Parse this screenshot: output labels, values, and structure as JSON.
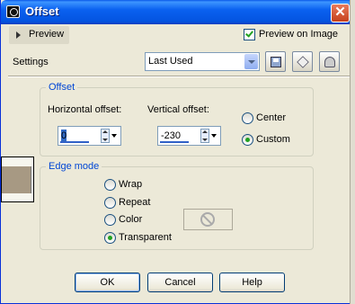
{
  "window": {
    "title": "Offset",
    "close_glyph": "✕"
  },
  "preview_toggle": {
    "label": "Preview"
  },
  "preview_on_image": {
    "label": "Preview on Image",
    "checked": true
  },
  "settings": {
    "label": "Settings",
    "value": "Last Used"
  },
  "offset_group": {
    "legend": "Offset",
    "horizontal": {
      "label": "Horizontal offset:",
      "value": "0"
    },
    "vertical": {
      "label": "Vertical offset:",
      "value": "-230"
    },
    "radios": [
      {
        "label": "Center",
        "selected": false
      },
      {
        "label": "Custom",
        "selected": true
      }
    ]
  },
  "edge_group": {
    "legend": "Edge mode",
    "radios": [
      {
        "label": "Wrap",
        "selected": false
      },
      {
        "label": "Repeat",
        "selected": false
      },
      {
        "label": "Color",
        "selected": false
      },
      {
        "label": "Transparent",
        "selected": true
      }
    ]
  },
  "buttons": {
    "ok": "OK",
    "cancel": "Cancel",
    "help": "Help"
  },
  "colors": {
    "title_bar": "#0a61f0",
    "swatch": "#a79983",
    "legend_text": "#0046d5"
  }
}
